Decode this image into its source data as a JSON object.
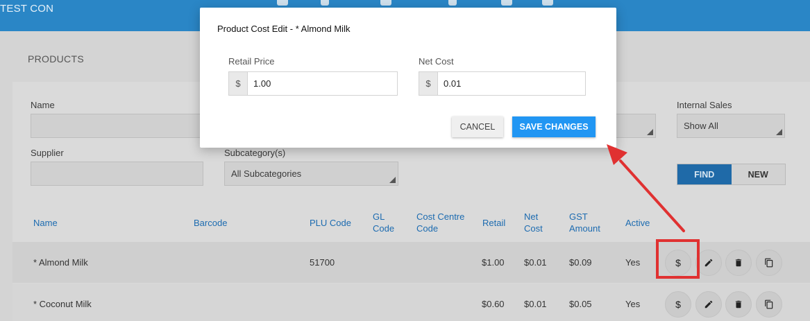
{
  "app": {
    "brand": "TEST CON"
  },
  "page": {
    "title": "PRODUCTS"
  },
  "filters": {
    "name_label": "Name",
    "name_value": "",
    "supplier_label": "Supplier",
    "supplier_value": "",
    "subcategory_label": "Subcategory(s)",
    "subcategory_value": "All Subcategories",
    "internal_sales_label": "Internal Sales",
    "internal_sales_value": "Show All",
    "find_label": "FIND",
    "new_label": "NEW"
  },
  "table": {
    "headers": {
      "name": "Name",
      "barcode": "Barcode",
      "plu": "PLU Code",
      "gl_code": "GL Code",
      "cost_centre": "Cost Centre Code",
      "retail": "Retail",
      "net_cost": "Net Cost",
      "gst": "GST Amount",
      "active": "Active"
    },
    "rows": [
      {
        "name": "* Almond Milk",
        "barcode": "",
        "plu": "51700",
        "gl_code": "",
        "cost_centre": "",
        "retail": "$1.00",
        "net_cost": "$0.01",
        "gst": "$0.09",
        "active": "Yes"
      },
      {
        "name": "* Coconut Milk",
        "barcode": "",
        "plu": "",
        "gl_code": "",
        "cost_centre": "",
        "retail": "$0.60",
        "net_cost": "$0.01",
        "gst": "$0.05",
        "active": "Yes"
      }
    ],
    "action_icons": {
      "cost": "$"
    }
  },
  "modal": {
    "title": "Product Cost Edit - * Almond Milk",
    "retail_label": "Retail Price",
    "retail_prefix": "$",
    "retail_value": "1.00",
    "net_label": "Net Cost",
    "net_prefix": "$",
    "net_value": "0.01",
    "cancel_label": "CANCEL",
    "save_label": "SAVE CHANGES"
  },
  "colors": {
    "header_bar": "#2a86c6",
    "primary_button": "#2196f3",
    "table_header_text": "#1c6bb0",
    "annotation": "#e03131"
  }
}
